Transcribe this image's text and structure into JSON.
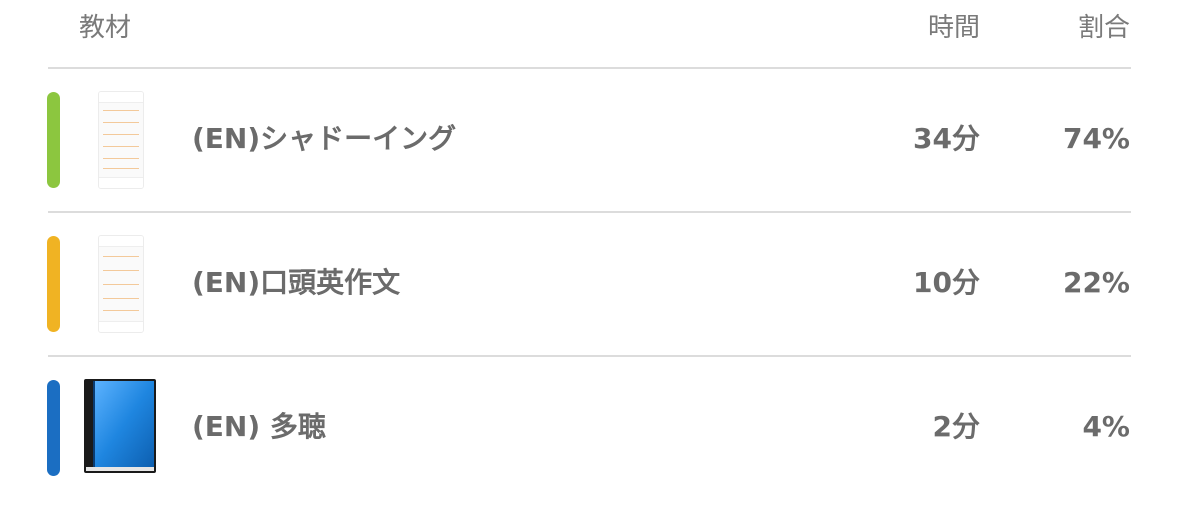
{
  "header": {
    "material_label": "教材",
    "time_label": "時間",
    "ratio_label": "割合"
  },
  "rows": [
    {
      "title": "(EN)シャドーイング",
      "time": "34分",
      "ratio": "74%",
      "color": "#8cc63f",
      "icon": "app-screenshot-thumbnail"
    },
    {
      "title": "(EN)口頭英作文",
      "time": "10分",
      "ratio": "22%",
      "color": "#f0b323",
      "icon": "app-screenshot-thumbnail"
    },
    {
      "title": "(EN) 多聴",
      "time": "2分",
      "ratio": "4%",
      "color": "#1b6ec2",
      "icon": "blue-book-icon"
    }
  ]
}
